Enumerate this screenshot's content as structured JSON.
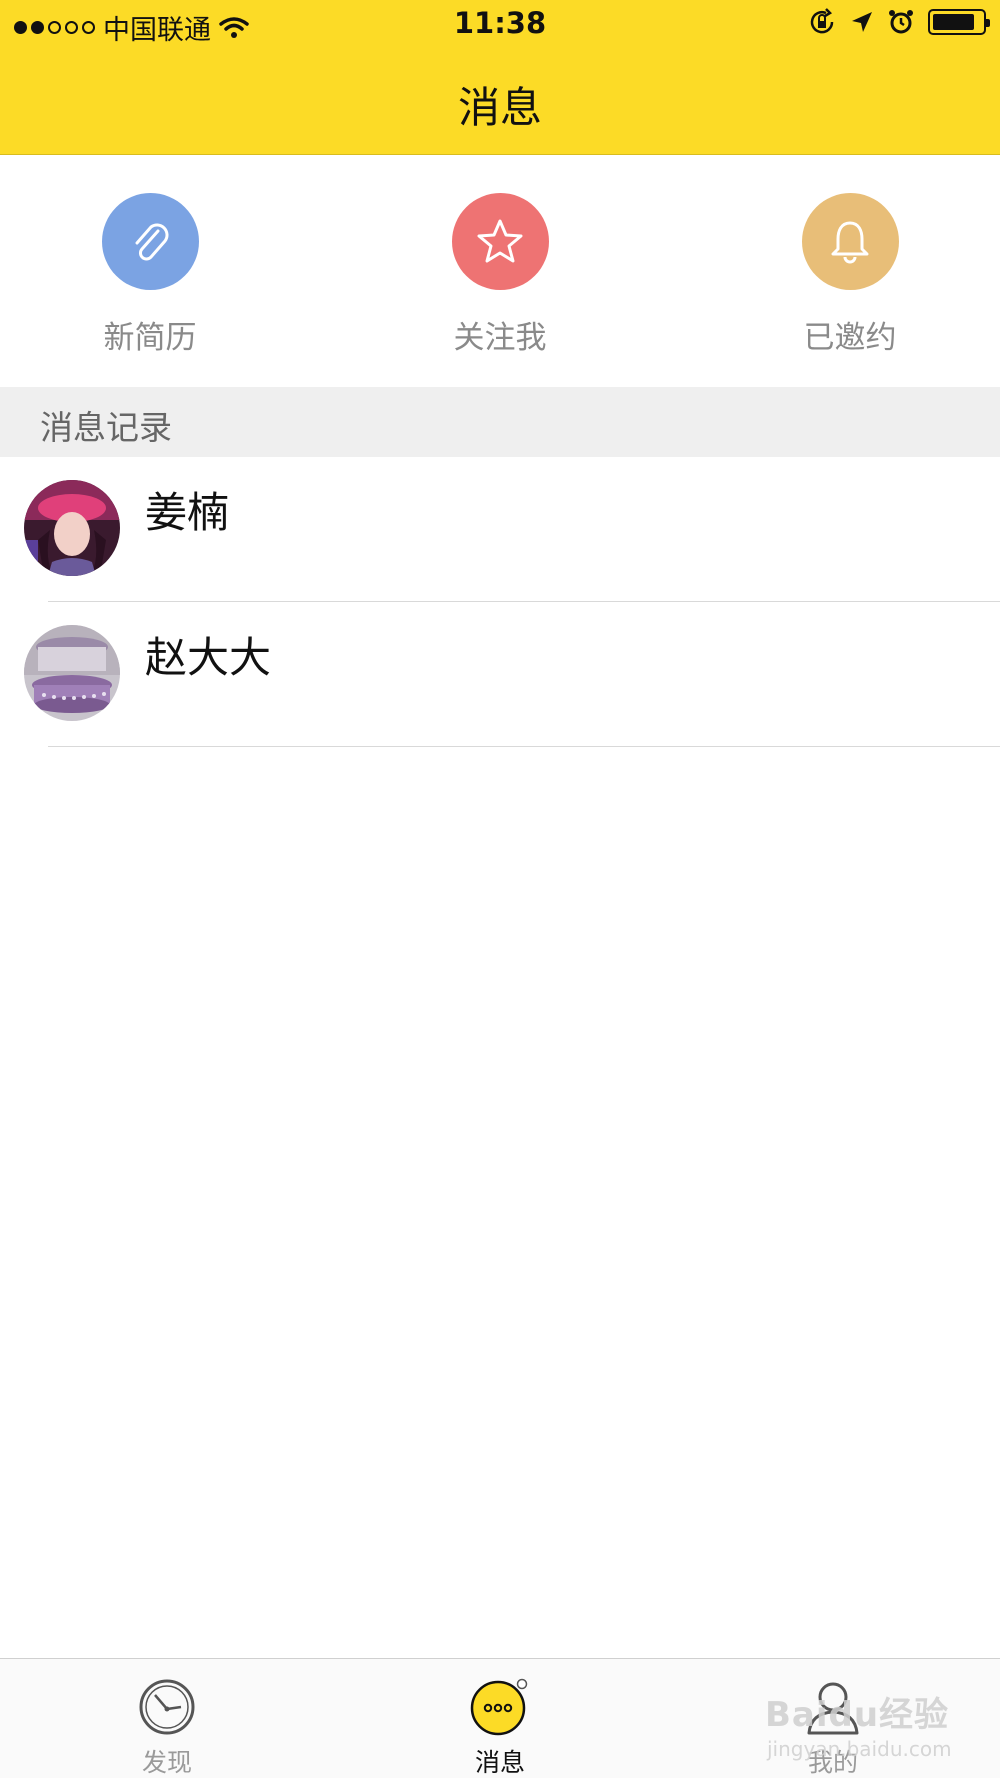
{
  "status_bar": {
    "carrier": "中国联通",
    "time": "11:38",
    "signal_filled": 2,
    "signal_total": 5,
    "icons": [
      "wifi-icon",
      "orientation-lock-icon",
      "location-arrow-icon",
      "alarm-icon",
      "battery-icon"
    ]
  },
  "header": {
    "title": "消息"
  },
  "quick_actions": [
    {
      "label": "新简历",
      "icon": "paperclip-icon",
      "color": "#7BA3E3"
    },
    {
      "label": "关注我",
      "icon": "star-icon",
      "color": "#EE7373"
    },
    {
      "label": "已邀约",
      "icon": "bell-icon",
      "color": "#E8BE78"
    }
  ],
  "section": {
    "title": "消息记录"
  },
  "messages": [
    {
      "name": "姜楠",
      "avatar": "avatar-photo"
    },
    {
      "name": "赵大大",
      "avatar": "avatar-photo"
    }
  ],
  "tabbar": {
    "tabs": [
      {
        "label": "发现",
        "icon": "compass-icon",
        "active": false
      },
      {
        "label": "消息",
        "icon": "chat-bubble-icon",
        "active": true
      },
      {
        "label": "我的",
        "icon": "person-icon",
        "active": false
      }
    ]
  },
  "watermark": {
    "text": "Baidu经验",
    "url": "jingyan.baidu.com"
  },
  "colors": {
    "header": "#FCDB26",
    "active_tab": "#FCDB26"
  }
}
